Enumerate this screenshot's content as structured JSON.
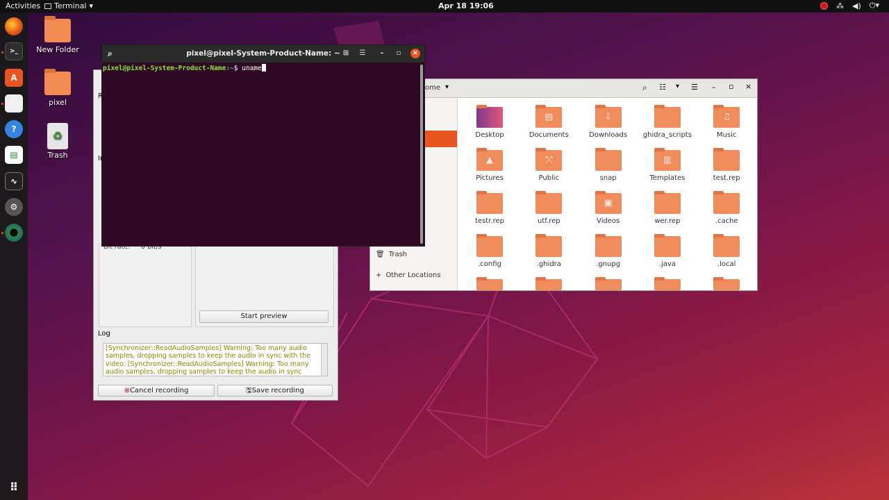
{
  "topbar": {
    "activities": "Activities",
    "app_menu": "Terminal",
    "clock": "Apr 18  19:06"
  },
  "desktop": {
    "icons": [
      {
        "label": "New Folder"
      },
      {
        "label": "pixel"
      },
      {
        "label": "Trash"
      }
    ]
  },
  "terminal": {
    "title": "pixel@pixel-System-Product-Name: ~",
    "prompt_user": "pixel@pixel-System-Product-Name",
    "prompt_path": ":~",
    "prompt_symbol": "$ ",
    "command": "uname"
  },
  "files": {
    "path_label": "ome",
    "sidebar": {
      "trash": "Trash",
      "other_locations": "Other Locations"
    },
    "items": [
      {
        "label": "Desktop",
        "icon": "desktop-folder-icon"
      },
      {
        "label": "Documents",
        "icon": "documents-folder-icon"
      },
      {
        "label": "Downloads",
        "icon": "downloads-folder-icon"
      },
      {
        "label": "ghidra_scripts",
        "icon": "folder-icon"
      },
      {
        "label": "Music",
        "icon": "music-folder-icon"
      },
      {
        "label": "Pictures",
        "icon": "pictures-folder-icon"
      },
      {
        "label": "Public",
        "icon": "public-folder-icon"
      },
      {
        "label": "snap",
        "icon": "folder-icon"
      },
      {
        "label": "Templates",
        "icon": "templates-folder-icon"
      },
      {
        "label": "test.rep",
        "icon": "folder-icon"
      },
      {
        "label": "testr.rep",
        "icon": "folder-icon"
      },
      {
        "label": "utf.rep",
        "icon": "folder-icon"
      },
      {
        "label": "Videos",
        "icon": "videos-folder-icon"
      },
      {
        "label": "wer.rep",
        "icon": "folder-icon"
      },
      {
        "label": ".cache",
        "icon": "folder-icon"
      },
      {
        "label": ".config",
        "icon": "folder-icon"
      },
      {
        "label": ".ghidra",
        "icon": "folder-icon"
      },
      {
        "label": ".gnupg",
        "icon": "folder-icon"
      },
      {
        "label": ".java",
        "icon": "folder-icon"
      },
      {
        "label": ".local",
        "icon": "folder-icon"
      }
    ]
  },
  "recorder": {
    "bitrate_label": "Bit rate:",
    "bitrate_value": "0 bit/s",
    "start_preview": "Start preview",
    "log_title": "Log",
    "log_text": "[Synchronizer::ReadAudioSamples] Warning: Too many audio samples, dropping samples to keep the audio in sync with the video. [Synchronizer::ReadAudioSamples] Warning: Too many audio samples, dropping samples to keep the audio in sync with the video.",
    "cancel": "Cancel recording",
    "save": "Save recording",
    "partial_r": "R",
    "partial_i": "In"
  },
  "colors": {
    "accent": "#e95420",
    "terminal_bg": "#300a24",
    "folder": "#f08b5c"
  }
}
